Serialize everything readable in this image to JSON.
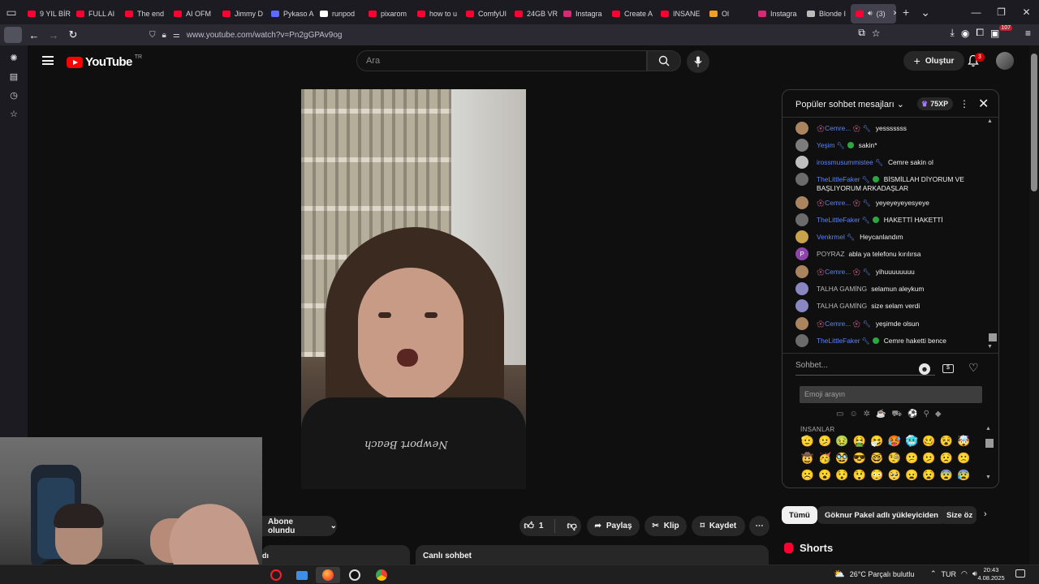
{
  "browser": {
    "tabs": [
      {
        "title": "9 YIL BİR",
        "favicon_color": "#ff0033"
      },
      {
        "title": "FULL AI",
        "favicon_color": "#ff0033"
      },
      {
        "title": "The end",
        "favicon_color": "#ff0033"
      },
      {
        "title": "AI OFM",
        "favicon_color": "#ff0033"
      },
      {
        "title": "Jimmy D",
        "favicon_color": "#ff0033"
      },
      {
        "title": "Pykaso A",
        "favicon_color": "#5b6cff"
      },
      {
        "title": "runpod",
        "favicon_color": "#ffffff"
      },
      {
        "title": "pixarom",
        "favicon_color": "#ff0033"
      },
      {
        "title": "how to u",
        "favicon_color": "#ff0033"
      },
      {
        "title": "ComfyUI",
        "favicon_color": "#ff0033"
      },
      {
        "title": "24GB VR",
        "favicon_color": "#ff0033"
      },
      {
        "title": "Instagra",
        "favicon_color": "#d62976"
      },
      {
        "title": "Create A",
        "favicon_color": "#ff0033"
      },
      {
        "title": "INSANE",
        "favicon_color": "#ff0033"
      },
      {
        "title": "Ol",
        "favicon_color": "#f0a020"
      },
      {
        "title": "Instagra",
        "favicon_color": "#d62976"
      },
      {
        "title": "Blonde I",
        "favicon_color": "#bbbbbb"
      },
      {
        "title": "(3)",
        "favicon_color": "#ff0033",
        "active": true
      }
    ],
    "url": "www.youtube.com/watch?v=Pn2gGPAv9og",
    "extensions_badge": "107"
  },
  "youtube": {
    "logo_text": "YouTube",
    "country_code": "TR",
    "search_placeholder": "Ara",
    "create_label": "Oluştur",
    "notifications_count": "3"
  },
  "video_actions": {
    "subscribed_label": "Abone olundu",
    "like_count": "1",
    "share_label": "Paylaş",
    "clip_label": "Klip",
    "save_label": "Kaydet"
  },
  "video": {
    "shirt_print": "Newport Beach"
  },
  "below": {
    "description_fragment": "dı",
    "livechat_label": "Canlı sohbet"
  },
  "chat": {
    "title": "Popüler sohbet mesajları",
    "xp_label": "75XP",
    "input_placeholder": "Sohbet...",
    "emoji_search_placeholder": "Emoji arayın",
    "emoji_section_label": "İNSANLAR",
    "messages": [
      {
        "author": "Cemre...",
        "text": "yesssssss",
        "avatar_color": "#a9845e",
        "author_color": "#5e84f1",
        "badge": "flower"
      },
      {
        "author": "Yeşim",
        "text": "sakin*",
        "avatar_color": "#7c7c7c",
        "author_color": "#5e84f1",
        "badge": "mod-check"
      },
      {
        "author": "irossmusummistee",
        "text": "Cemre sakin ol",
        "avatar_color": "#bfbfbf",
        "author_color": "#5e84f1",
        "badge": "mod"
      },
      {
        "author": "TheLittleFaker",
        "text": "BİSMİLLAH DİYORUM VE BAŞLIYORUM ARKADAŞLAR",
        "avatar_color": "#6b6b6b",
        "author_color": "#5e84f1",
        "badge": "mod-check"
      },
      {
        "author": "Cemre...",
        "text": "yeyeyeyeyesyeye",
        "avatar_color": "#a9845e",
        "author_color": "#5e84f1",
        "badge": "flower"
      },
      {
        "author": "TheLittleFaker",
        "text": "HAKETTİ HAKETTİ",
        "avatar_color": "#6b6b6b",
        "author_color": "#5e84f1",
        "badge": "mod-check"
      },
      {
        "author": "Venkrmel",
        "text": "Heycanlandım",
        "avatar_color": "#c9a24c",
        "author_color": "#5e84f1",
        "badge": "mod"
      },
      {
        "author": "POYRAZ",
        "text": "abla ya telefonu kırılırsa",
        "avatar_color": "#8e44ad",
        "avatar_letter": "P",
        "author_color": "#b8b8b8",
        "badge": "none"
      },
      {
        "author": "Cemre...",
        "text": "yihuuuuuuuu",
        "avatar_color": "#a9845e",
        "author_color": "#5e84f1",
        "badge": "flower"
      },
      {
        "author": "TALHA GAMİNG",
        "text": "selamun aleykum",
        "avatar_color": "#8a86c0",
        "author_color": "#b8b8b8",
        "badge": "none"
      },
      {
        "author": "TALHA GAMİNG",
        "text": "size selam verdi",
        "avatar_color": "#8a86c0",
        "author_color": "#b8b8b8",
        "badge": "none"
      },
      {
        "author": "Cemre...",
        "text": "yeşimde olsun",
        "avatar_color": "#a9845e",
        "author_color": "#5e84f1",
        "badge": "flower"
      },
      {
        "author": "TheLittleFaker",
        "text": "Cemre haketti bence",
        "avatar_color": "#6b6b6b",
        "author_color": "#5e84f1",
        "badge": "mod-check"
      }
    ],
    "emojis": [
      "🫡",
      "🫤",
      "🤢",
      "🤮",
      "🤧",
      "🥵",
      "🥶",
      "🥴",
      "😵",
      "🤯",
      "🤠",
      "🥳",
      "🥸",
      "😎",
      "🤓",
      "🧐",
      "😕",
      "🫤",
      "😟",
      "🙁",
      "☹️",
      "😮",
      "😯",
      "😲",
      "😳",
      "🥺",
      "😦",
      "😧",
      "😨",
      "😰"
    ]
  },
  "chips": [
    "Tümü",
    "Göknur Pakel adlı yükleyiciden",
    "Size öz"
  ],
  "shorts_title": "Shorts",
  "taskbar": {
    "weather": "26°C  Parçalı bulutlu",
    "language": "TUR",
    "time": "20:43",
    "date": "4.08.2025"
  }
}
